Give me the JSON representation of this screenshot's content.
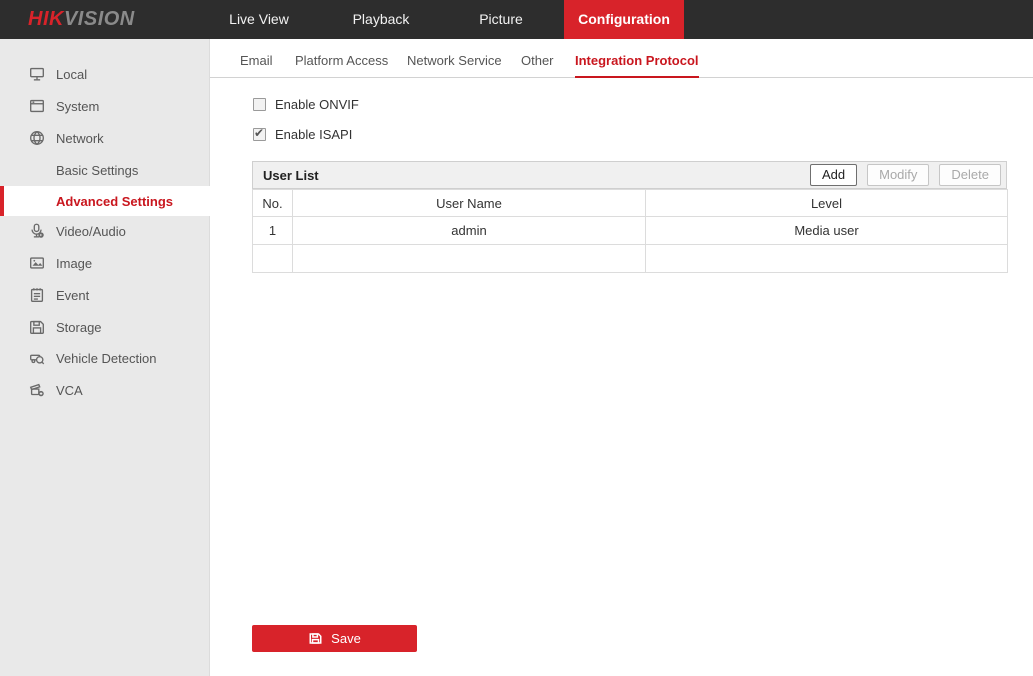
{
  "top_nav": {
    "logo": {
      "hik": "HIK",
      "vision": "VISION"
    },
    "items": [
      {
        "label": "Live View",
        "active": false
      },
      {
        "label": "Playback",
        "active": false
      },
      {
        "label": "Picture",
        "active": false
      },
      {
        "label": "Configuration",
        "active": true
      }
    ]
  },
  "sidebar": {
    "items": [
      {
        "label": "Local",
        "icon": "monitor-icon"
      },
      {
        "label": "System",
        "icon": "window-icon"
      },
      {
        "label": "Network",
        "icon": "globe-icon"
      },
      {
        "label": "Basic Settings",
        "sub": true
      },
      {
        "label": "Advanced Settings",
        "sub": true,
        "active": true
      },
      {
        "label": "Video/Audio",
        "icon": "microphone-icon"
      },
      {
        "label": "Image",
        "icon": "image-icon"
      },
      {
        "label": "Event",
        "icon": "event-icon"
      },
      {
        "label": "Storage",
        "icon": "storage-icon"
      },
      {
        "label": "Vehicle Detection",
        "icon": "vehicle-detection-icon"
      },
      {
        "label": "VCA",
        "icon": "vca-icon"
      }
    ]
  },
  "tabs": [
    {
      "label": "Email",
      "active": false
    },
    {
      "label": "Platform Access",
      "active": false
    },
    {
      "label": "Network Service",
      "active": false
    },
    {
      "label": "Other",
      "active": false
    },
    {
      "label": "Integration Protocol",
      "active": true
    }
  ],
  "settings": {
    "onvif": {
      "label": "Enable ONVIF",
      "checked": false
    },
    "isapi": {
      "label": "Enable ISAPI",
      "checked": true
    }
  },
  "user_list": {
    "title": "User List",
    "buttons": [
      {
        "label": "Add",
        "enabled": true
      },
      {
        "label": "Modify",
        "enabled": false
      },
      {
        "label": "Delete",
        "enabled": false
      }
    ],
    "columns": [
      "No.",
      "User Name",
      "Level"
    ],
    "rows": [
      {
        "no": "1",
        "user_name": "admin",
        "level": "Media user"
      }
    ]
  },
  "save": {
    "label": "Save"
  },
  "colors": {
    "accent_red": "#d8232a",
    "active_text_red": "#c9161e",
    "nav_bg": "#2d2d2d",
    "sidebar_bg": "#e9e9e9",
    "panel_header_bg": "#f0f0f0"
  }
}
